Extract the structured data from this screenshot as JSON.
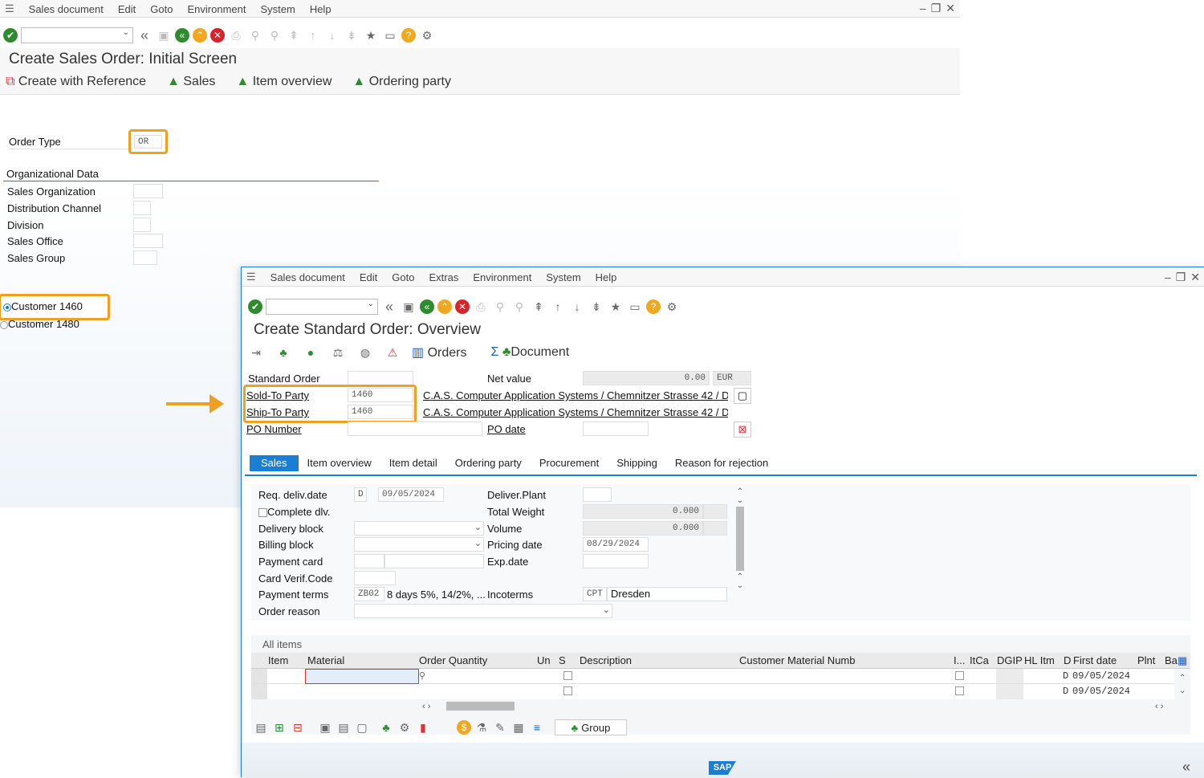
{
  "back": {
    "menu": [
      "Sales document",
      "Edit",
      "Goto",
      "Environment",
      "System",
      "Help"
    ],
    "title": "Create Sales Order: Initial Screen",
    "app_buttons": [
      "Create with Reference",
      "Sales",
      "Item overview",
      "Ordering party"
    ],
    "order_type_label": "Order Type",
    "order_type_value": "OR",
    "org_header": "Organizational Data",
    "org_fields": [
      "Sales Organization",
      "Distribution Channel",
      "Division",
      "Sales Office",
      "Sales Group"
    ],
    "radios": [
      "Customer 1460",
      "Customer 1480"
    ]
  },
  "front": {
    "menu": [
      "Sales document",
      "Edit",
      "Goto",
      "Extras",
      "Environment",
      "System",
      "Help"
    ],
    "title": "Create Standard Order: Overview",
    "app_orders": "Orders",
    "app_document": "Document",
    "header": {
      "standard_order": "Standard Order",
      "net_value_label": "Net value",
      "net_value": "0.00",
      "currency": "EUR",
      "sold_to_label": "Sold-To Party",
      "sold_to": "1460",
      "sold_to_name": "C.A.S. Computer Application Systems / Chemnitzer Strasse 42 / D-...",
      "ship_to_label": "Ship-To Party",
      "ship_to": "1460",
      "ship_to_name": "C.A.S. Computer Application Systems / Chemnitzer Strasse 42 / D-...",
      "po_number": "PO Number",
      "po_date": "PO date"
    },
    "tabs": [
      "Sales",
      "Item overview",
      "Item detail",
      "Ordering party",
      "Procurement",
      "Shipping",
      "Reason for rejection"
    ],
    "sales": {
      "req_deliv": "Req. deliv.date",
      "req_deliv_flag": "D",
      "req_deliv_value": "09/05/2024",
      "complete_dlv": "Complete dlv.",
      "delivery_block": "Delivery block",
      "billing_block": "Billing block",
      "payment_card": "Payment card",
      "card_verif": "Card Verif.Code",
      "payment_terms": "Payment terms",
      "payment_terms_code": "ZB02",
      "payment_terms_text": "8 days 5%, 14/2%, ...",
      "order_reason": "Order reason",
      "deliver_plant": "Deliver.Plant",
      "total_weight": "Total Weight",
      "total_weight_value": "0.000",
      "volume": "Volume",
      "volume_value": "0.000",
      "pricing_date": "Pricing date",
      "pricing_date_value": "08/29/2024",
      "exp_date": "Exp.date",
      "incoterms": "Incoterms",
      "incoterms_code": "CPT",
      "incoterms_place": "Dresden"
    },
    "items": {
      "caption": "All items",
      "columns": [
        "Item",
        "Material",
        "Order Quantity",
        "Un",
        "S",
        "Description",
        "Customer Material Numb",
        "I...",
        "ItCa",
        "DGIP",
        "HL Itm",
        "D",
        "First date",
        "Plnt",
        "Ba"
      ],
      "rows": [
        {
          "d": "D",
          "date": "09/05/2024"
        },
        {
          "d": "D",
          "date": "09/05/2024"
        }
      ],
      "group_button": "Group"
    },
    "sap_logo": "SAP"
  }
}
